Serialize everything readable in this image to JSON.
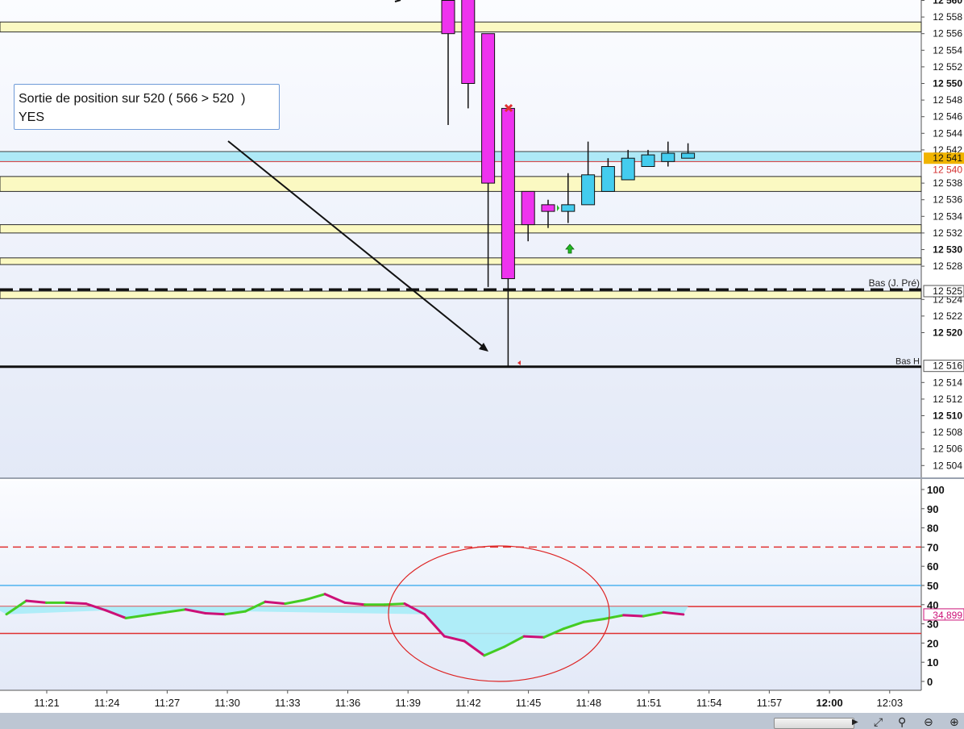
{
  "annotation": {
    "line1": "Sortie de position sur 520 ( 566 > 520  )",
    "line2": "YES"
  },
  "chart_data": [
    {
      "type": "candlestick",
      "yrange": [
        12503,
        12561
      ],
      "ytick_labels": [
        {
          "value": 12560,
          "label": "12 560",
          "bold": true
        },
        {
          "value": 12558,
          "label": "12 558"
        },
        {
          "value": 12556,
          "label": "12 556"
        },
        {
          "value": 12554,
          "label": "12 554"
        },
        {
          "value": 12552,
          "label": "12 552"
        },
        {
          "value": 12550,
          "label": "12 550",
          "bold": true
        },
        {
          "value": 12548,
          "label": "12 548"
        },
        {
          "value": 12546,
          "label": "12 546"
        },
        {
          "value": 12544,
          "label": "12 544"
        },
        {
          "value": 12542,
          "label": "12 542"
        },
        {
          "value": 12538,
          "label": "12 538"
        },
        {
          "value": 12536,
          "label": "12 536"
        },
        {
          "value": 12534,
          "label": "12 534"
        },
        {
          "value": 12532,
          "label": "12 532"
        },
        {
          "value": 12530,
          "label": "12 530",
          "bold": true
        },
        {
          "value": 12528,
          "label": "12 528"
        },
        {
          "value": 12524,
          "label": "12 524"
        },
        {
          "value": 12522,
          "label": "12 522"
        },
        {
          "value": 12520,
          "label": "12 520",
          "bold": true
        },
        {
          "value": 12514,
          "label": "12 514"
        },
        {
          "value": 12512,
          "label": "12 512"
        },
        {
          "value": 12510,
          "label": "12 510",
          "bold": true
        },
        {
          "value": 12508,
          "label": "12 508"
        },
        {
          "value": 12506,
          "label": "12 506"
        },
        {
          "value": 12504,
          "label": "12 504"
        }
      ],
      "price_markers": [
        {
          "value": 12541,
          "label": "12 541",
          "style": "current",
          "color": "#f0b400"
        },
        {
          "value": 12540,
          "label": "12 540",
          "style": "red-text",
          "color": "#d43030"
        },
        {
          "value": 12525,
          "label": "12 525",
          "style": "boxed",
          "color": "#555555"
        },
        {
          "value": 12516,
          "label": "12 516",
          "style": "boxed",
          "color": "#555555"
        }
      ],
      "zones": [
        {
          "from": 12556.2,
          "to": 12557.4
        },
        {
          "from": 12537,
          "to": 12538.8
        },
        {
          "from": 12532,
          "to": 12533
        },
        {
          "from": 12528.2,
          "to": 12529
        },
        {
          "from": 12524.1,
          "to": 12525
        }
      ],
      "highlight_band": {
        "from": 12540.6,
        "to": 12541.8,
        "color": "#aee9f7"
      },
      "red_line": 12540.6,
      "dashed_line": {
        "value": 12525.2,
        "label": "Bas (J. Pré)"
      },
      "solid_line": {
        "value": 12515.9,
        "label": "Bas H"
      },
      "candles": [
        {
          "time": "11:40",
          "open": 12560,
          "high": 12562,
          "low": 12545,
          "close": 12556
        },
        {
          "time": "11:41",
          "open": 12562,
          "high": 12562,
          "low": 12547,
          "close": 12550
        },
        {
          "time": "11:42",
          "open": 12556,
          "high": 12556,
          "low": 12525.5,
          "close": 12538
        },
        {
          "time": "11:43",
          "open": 12547,
          "high": 12547,
          "low": 12515.9,
          "close": 12526.5
        },
        {
          "time": "11:44",
          "open": 12537,
          "high": 12537,
          "low": 12531,
          "close": 12533
        },
        {
          "time": "11:45",
          "open": 12535.4,
          "high": 12536,
          "low": 12532.6,
          "close": 12534.6
        },
        {
          "time": "11:46",
          "open": 12534.6,
          "high": 12539.2,
          "low": 12533.2,
          "close": 12535.4
        },
        {
          "time": "11:47",
          "open": 12535.4,
          "high": 12543,
          "low": 12535.4,
          "close": 12539
        },
        {
          "time": "11:48",
          "open": 12537,
          "high": 12541,
          "low": 12537,
          "close": 12540
        },
        {
          "time": "11:49",
          "open": 12538.4,
          "high": 12542,
          "low": 12538.4,
          "close": 12541
        },
        {
          "time": "11:50",
          "open": 12540,
          "high": 12542,
          "low": 12540,
          "close": 12541.4
        },
        {
          "time": "11:51",
          "open": 12540.6,
          "high": 12543,
          "low": 12540,
          "close": 12541.6
        },
        {
          "time": "11:52",
          "open": 12541,
          "high": 12542.8,
          "low": 12541,
          "close": 12541.6
        }
      ]
    },
    {
      "type": "line",
      "ylim": [
        -5,
        105
      ],
      "yticks": [
        0,
        10,
        20,
        30,
        40,
        50,
        60,
        70,
        80,
        90,
        100
      ],
      "ytick_labels": [
        "0",
        "10",
        "20",
        "30",
        "40",
        "50",
        "60",
        "70",
        "80",
        "90",
        "100"
      ],
      "levels": [
        {
          "value": 70,
          "style": "dashed",
          "color": "#e03030"
        },
        {
          "value": 50,
          "style": "solid",
          "color": "#4fb3f0"
        },
        {
          "value": 39,
          "style": "solid",
          "color": "#e03030"
        },
        {
          "value": 25,
          "style": "solid",
          "color": "#e03030"
        }
      ],
      "x_labels": [
        "11:21",
        "11:24",
        "11:27",
        "11:30",
        "11:33",
        "11:36",
        "11:39",
        "11:42",
        "11:45",
        "11:48",
        "11:51",
        "11:54",
        "11:57",
        "12:00",
        "12:03"
      ],
      "bold_x_label": "12:00",
      "last_value_label": "34,899",
      "series": [
        {
          "color_up": "#44cc22",
          "color_down": "#cc1177",
          "x": [
            0,
            1,
            2,
            3,
            4,
            5,
            6,
            7,
            8,
            9,
            10,
            11,
            12,
            13,
            14,
            15,
            16,
            17,
            18,
            19,
            20,
            21,
            22,
            23,
            24,
            25,
            26,
            27,
            28,
            29,
            30,
            31,
            32,
            33,
            34
          ],
          "values": [
            35,
            42,
            41,
            41,
            40.5,
            37,
            33,
            34.5,
            36,
            37.5,
            35.5,
            35,
            36.5,
            41.5,
            40.5,
            42.5,
            45.5,
            41,
            40,
            40,
            40.5,
            35,
            23.5,
            21,
            13.5,
            18,
            23.5,
            23,
            27.5,
            31,
            32.5,
            34.5,
            34,
            36,
            34.899
          ]
        }
      ]
    }
  ]
}
